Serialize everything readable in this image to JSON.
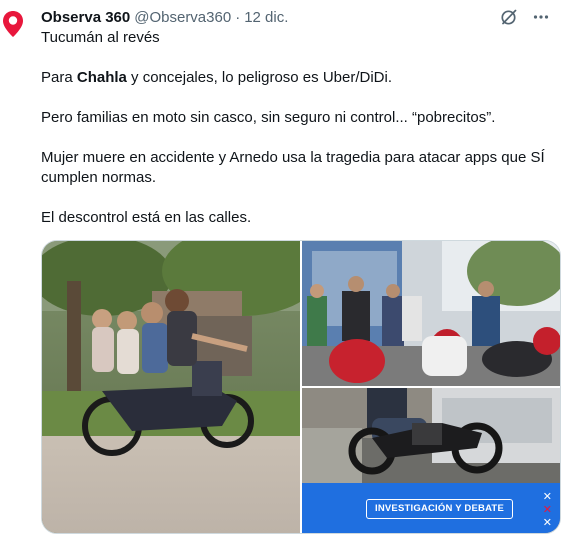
{
  "tweet": {
    "author_name": "Observa 360",
    "handle": "@Observa360",
    "separator": "·",
    "date": "12 dic.",
    "lines": {
      "l1": "Tucumán al revés",
      "l2_pre": "Para ",
      "l2_bold": "Chahla",
      "l2_post": " y concejales, lo peligroso es Uber/DiDi.",
      "l3": "Pero familias en moto sin casco, sin seguro ni control... “pobrecitos”.",
      "l4": "Mujer muere en accidente y Arnedo usa la tragedia para atacar apps que SÍ cumplen normas.",
      "l5": "El descontrol está en las calles."
    },
    "actions": {
      "grok_icon": "grok-icon",
      "more_icon": "more-icon",
      "more_label": "···"
    }
  },
  "media": {
    "images": [
      {
        "name": "family-on-motorcycle-photo"
      },
      {
        "name": "motorcyclists-crowd-photo"
      },
      {
        "name": "motorcycle-street-photo"
      }
    ],
    "banner": {
      "label": "INVESTIGACIÓN Y DEBATE",
      "color": "#1f6fe0"
    }
  },
  "colors": {
    "accent": "#e8173c",
    "text": "#0f1419",
    "secondary": "#536471"
  }
}
